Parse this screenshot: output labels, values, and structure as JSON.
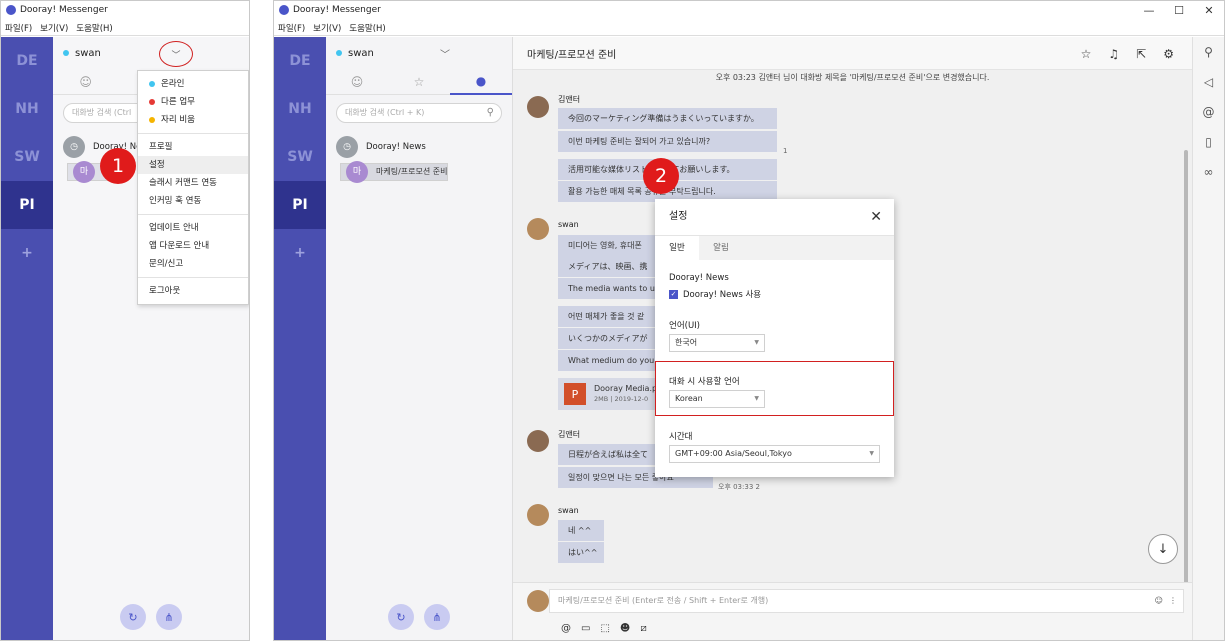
{
  "app_title": "Dooray! Messenger",
  "menu": [
    "파일(F)",
    "보기(V)",
    "도움말(H)"
  ],
  "window_controls": {
    "minimize": "—",
    "maximize": "☐",
    "close": "✕"
  },
  "workspaces": [
    "DE",
    "NH",
    "SW",
    "PI",
    "+"
  ],
  "user": {
    "name": "swan",
    "status_color": "#41c5f0"
  },
  "search_placeholder": "대화방 검색 (Ctrl + K)",
  "search_placeholder_short": "대화방 검색 (Ctrl",
  "chats": [
    {
      "name": "Dooray! News",
      "avatar": "news-icon"
    },
    {
      "name": "마케팅/프로모션 준비",
      "avatar_label": "마"
    }
  ],
  "chat_short": {
    "news": "Dooray! Ne",
    "room": "마케"
  },
  "dropdown": {
    "statuses": [
      {
        "label": "온라인",
        "color": "#41c5f0"
      },
      {
        "label": "다른 업무",
        "color": "#e53935"
      },
      {
        "label": "자리 비움",
        "color": "#f5b400"
      }
    ],
    "group2": [
      "프로필",
      "설정",
      "슬래시 커맨드 연동",
      "인커밍 훅 연동"
    ],
    "group3": [
      "업데이트 안내",
      "앱 다운로드 안내",
      "문의/신고"
    ],
    "group4": [
      "로그아웃"
    ]
  },
  "badges": [
    "1",
    "2"
  ],
  "conversation": {
    "title": "마케팅/프로모션 준비",
    "system_message": "오후 03:23  김앤터 님이 대화방 제목을 '마케팅/프로모션 준비'으로 변경했습니다.",
    "sender1": "김앤터",
    "sender2": "swan",
    "m1a": "今回のマーケティング準備はうまくいっていますか。",
    "m1b": "이번 마케팅 준비는 잘되어 가고 있습니까?",
    "m1c": "活用可能な媒体リストを教えてお願いします。",
    "m1d": "활용 가능한 매체 목록 공유를 부탁드립니다.",
    "m2a": "미디어는 영화, 휴대폰",
    "m2b": "メディアは、映画、携",
    "m2c": "The media wants to u",
    "m2d": "어떤 매체가 좋을 것  같",
    "m2e": "いくつかのメディアが",
    "m2f": "What medium do you",
    "file_name": "Dooray Media.pptx",
    "file_meta": "2MB | 2019-12-0",
    "file_icon": "P",
    "m3a": "日程が合えば私は全て",
    "m3b": "일정이 맞으면 나는 모든 좋아요",
    "m3_time": "오후 03:33",
    "m3_read": "2",
    "read1": "1",
    "m4a": "네 ^^",
    "m4b": "はい^^",
    "composer_placeholder": "마케팅/프로모션 준비  (Enter로 전송 / Shift + Enter로 개행)"
  },
  "settings_modal": {
    "title": "설정",
    "tabs": [
      "일반",
      "알림"
    ],
    "news_section": "Dooray! News",
    "news_checkbox": "Dooray! News 사용",
    "ui_lang_label": "언어(UI)",
    "ui_lang_value": "한국어",
    "chat_lang_label": "대화 시 사용할 언어",
    "chat_lang_value": "Korean",
    "tz_label": "시간대",
    "tz_value": "GMT+09:00 Asia/Seoul,Tokyo"
  },
  "colors": {
    "rail": "#4a4fb0",
    "rail_active": "#2f338e",
    "accent": "#4a55c9",
    "badge": "#e01b1b"
  }
}
